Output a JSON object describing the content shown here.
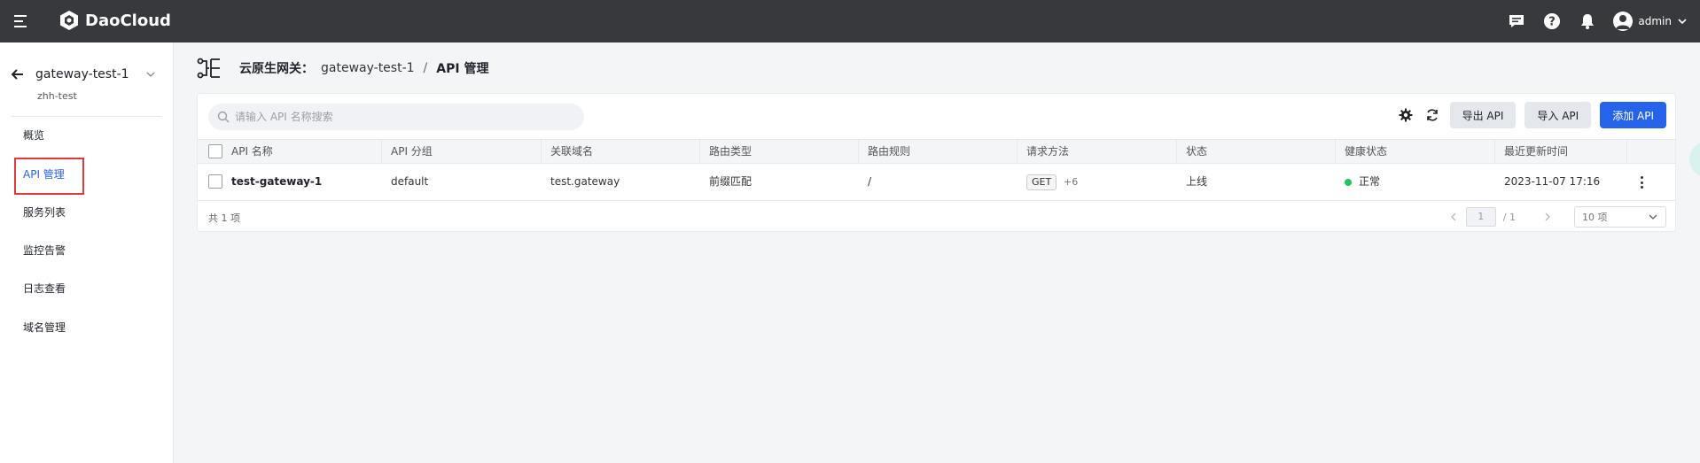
{
  "header": {
    "logo_text": "DaoCloud",
    "user_name": "admin"
  },
  "sidebar": {
    "gateway_name": "gateway-test-1",
    "workspace": "zhh-test",
    "items": [
      {
        "label": "概览"
      },
      {
        "label": "API 管理",
        "active": true
      },
      {
        "label": "服务列表"
      },
      {
        "label": "监控告警"
      },
      {
        "label": "日志查看"
      },
      {
        "label": "域名管理"
      }
    ]
  },
  "breadcrumb": {
    "section": "云原生网关：",
    "gateway": "gateway-test-1",
    "separator": "/",
    "current": "API 管理"
  },
  "toolbar": {
    "search_placeholder": "请输入 API 名称搜索",
    "export_label": "导出 API",
    "import_label": "导入 API",
    "add_label": "添加 API"
  },
  "table": {
    "columns": [
      "API 名称",
      "API 分组",
      "关联域名",
      "路由类型",
      "路由规则",
      "请求方法",
      "状态",
      "健康状态",
      "最近更新时间"
    ],
    "rows": [
      {
        "name": "test-gateway-1",
        "group": "default",
        "domain": "test.gateway",
        "route_type": "前缀匹配",
        "route_rule": "/",
        "method": "GET",
        "method_extra": "+6",
        "status": "上线",
        "health": "正常",
        "updated": "2023-11-07 17:16"
      }
    ]
  },
  "pagination": {
    "total_text": "共 1 项",
    "current_page": "1",
    "total_pages": "/ 1",
    "page_size": "10 项"
  },
  "colors": {
    "topbar": "#37393c",
    "primary": "#2563eb",
    "healthy": "#22c55e",
    "highlight_box": "#e23a3a"
  }
}
